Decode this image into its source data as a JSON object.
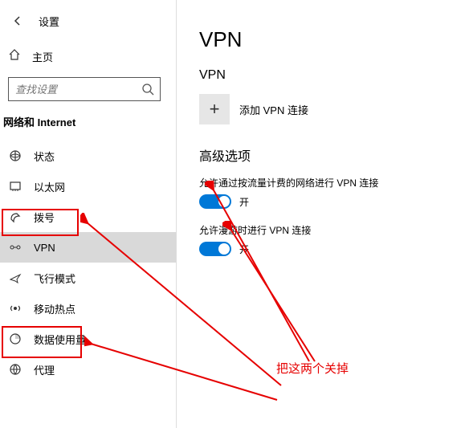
{
  "header": {
    "settings_label": "设置",
    "home_label": "主页"
  },
  "search": {
    "placeholder": "查找设置"
  },
  "section_title": "网络和 Internet",
  "sidebar": {
    "items": [
      {
        "label": "状态"
      },
      {
        "label": "以太网"
      },
      {
        "label": "拨号"
      },
      {
        "label": "VPN"
      },
      {
        "label": "飞行模式"
      },
      {
        "label": "移动热点"
      },
      {
        "label": "数据使用量"
      },
      {
        "label": "代理"
      }
    ]
  },
  "page": {
    "title": "VPN",
    "subtitle": "VPN",
    "add_label": "添加 VPN 连接",
    "advanced_heading": "高级选项",
    "opt1_label": "允许通过按流量计费的网络进行 VPN 连接",
    "opt1_state": "开",
    "opt2_label": "允许漫游时进行 VPN 连接",
    "opt2_state": "开"
  },
  "annotation": {
    "text": "把这两个关掉"
  }
}
